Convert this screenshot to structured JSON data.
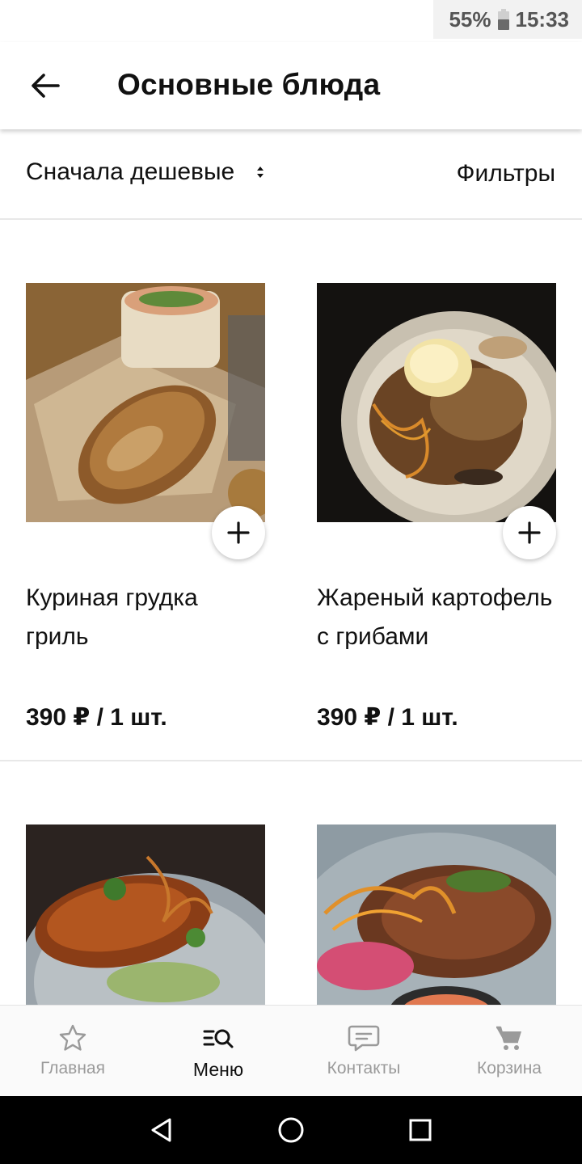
{
  "status_bar": {
    "battery": "55%",
    "battery_level": 0.55,
    "time": "15:33"
  },
  "header": {
    "title": "Основные блюда",
    "back_icon": "arrow-left-icon"
  },
  "toolbar": {
    "sort_label": "Сначала дешевые",
    "sort_icon": "sort-arrows-icon",
    "filters_label": "Фильтры"
  },
  "products": [
    {
      "name": "Куриная грудка гриль",
      "price": "390 ₽ / 1 шт."
    },
    {
      "name": "Жареный картофель с грибами",
      "price": "390 ₽ / 1 шт."
    },
    {
      "name": "",
      "price": ""
    },
    {
      "name": "",
      "price": ""
    }
  ],
  "bottom_nav": {
    "items": [
      {
        "label": "Главная",
        "icon": "star-icon"
      },
      {
        "label": "Меню",
        "icon": "menu-search-icon"
      },
      {
        "label": "Контакты",
        "icon": "chat-icon"
      },
      {
        "label": "Корзина",
        "icon": "cart-icon"
      }
    ],
    "active": "Меню"
  },
  "colors": {
    "text": "#111111",
    "muted": "#9a9a9a",
    "divider": "#e8e8e8",
    "background": "#ffffff"
  }
}
